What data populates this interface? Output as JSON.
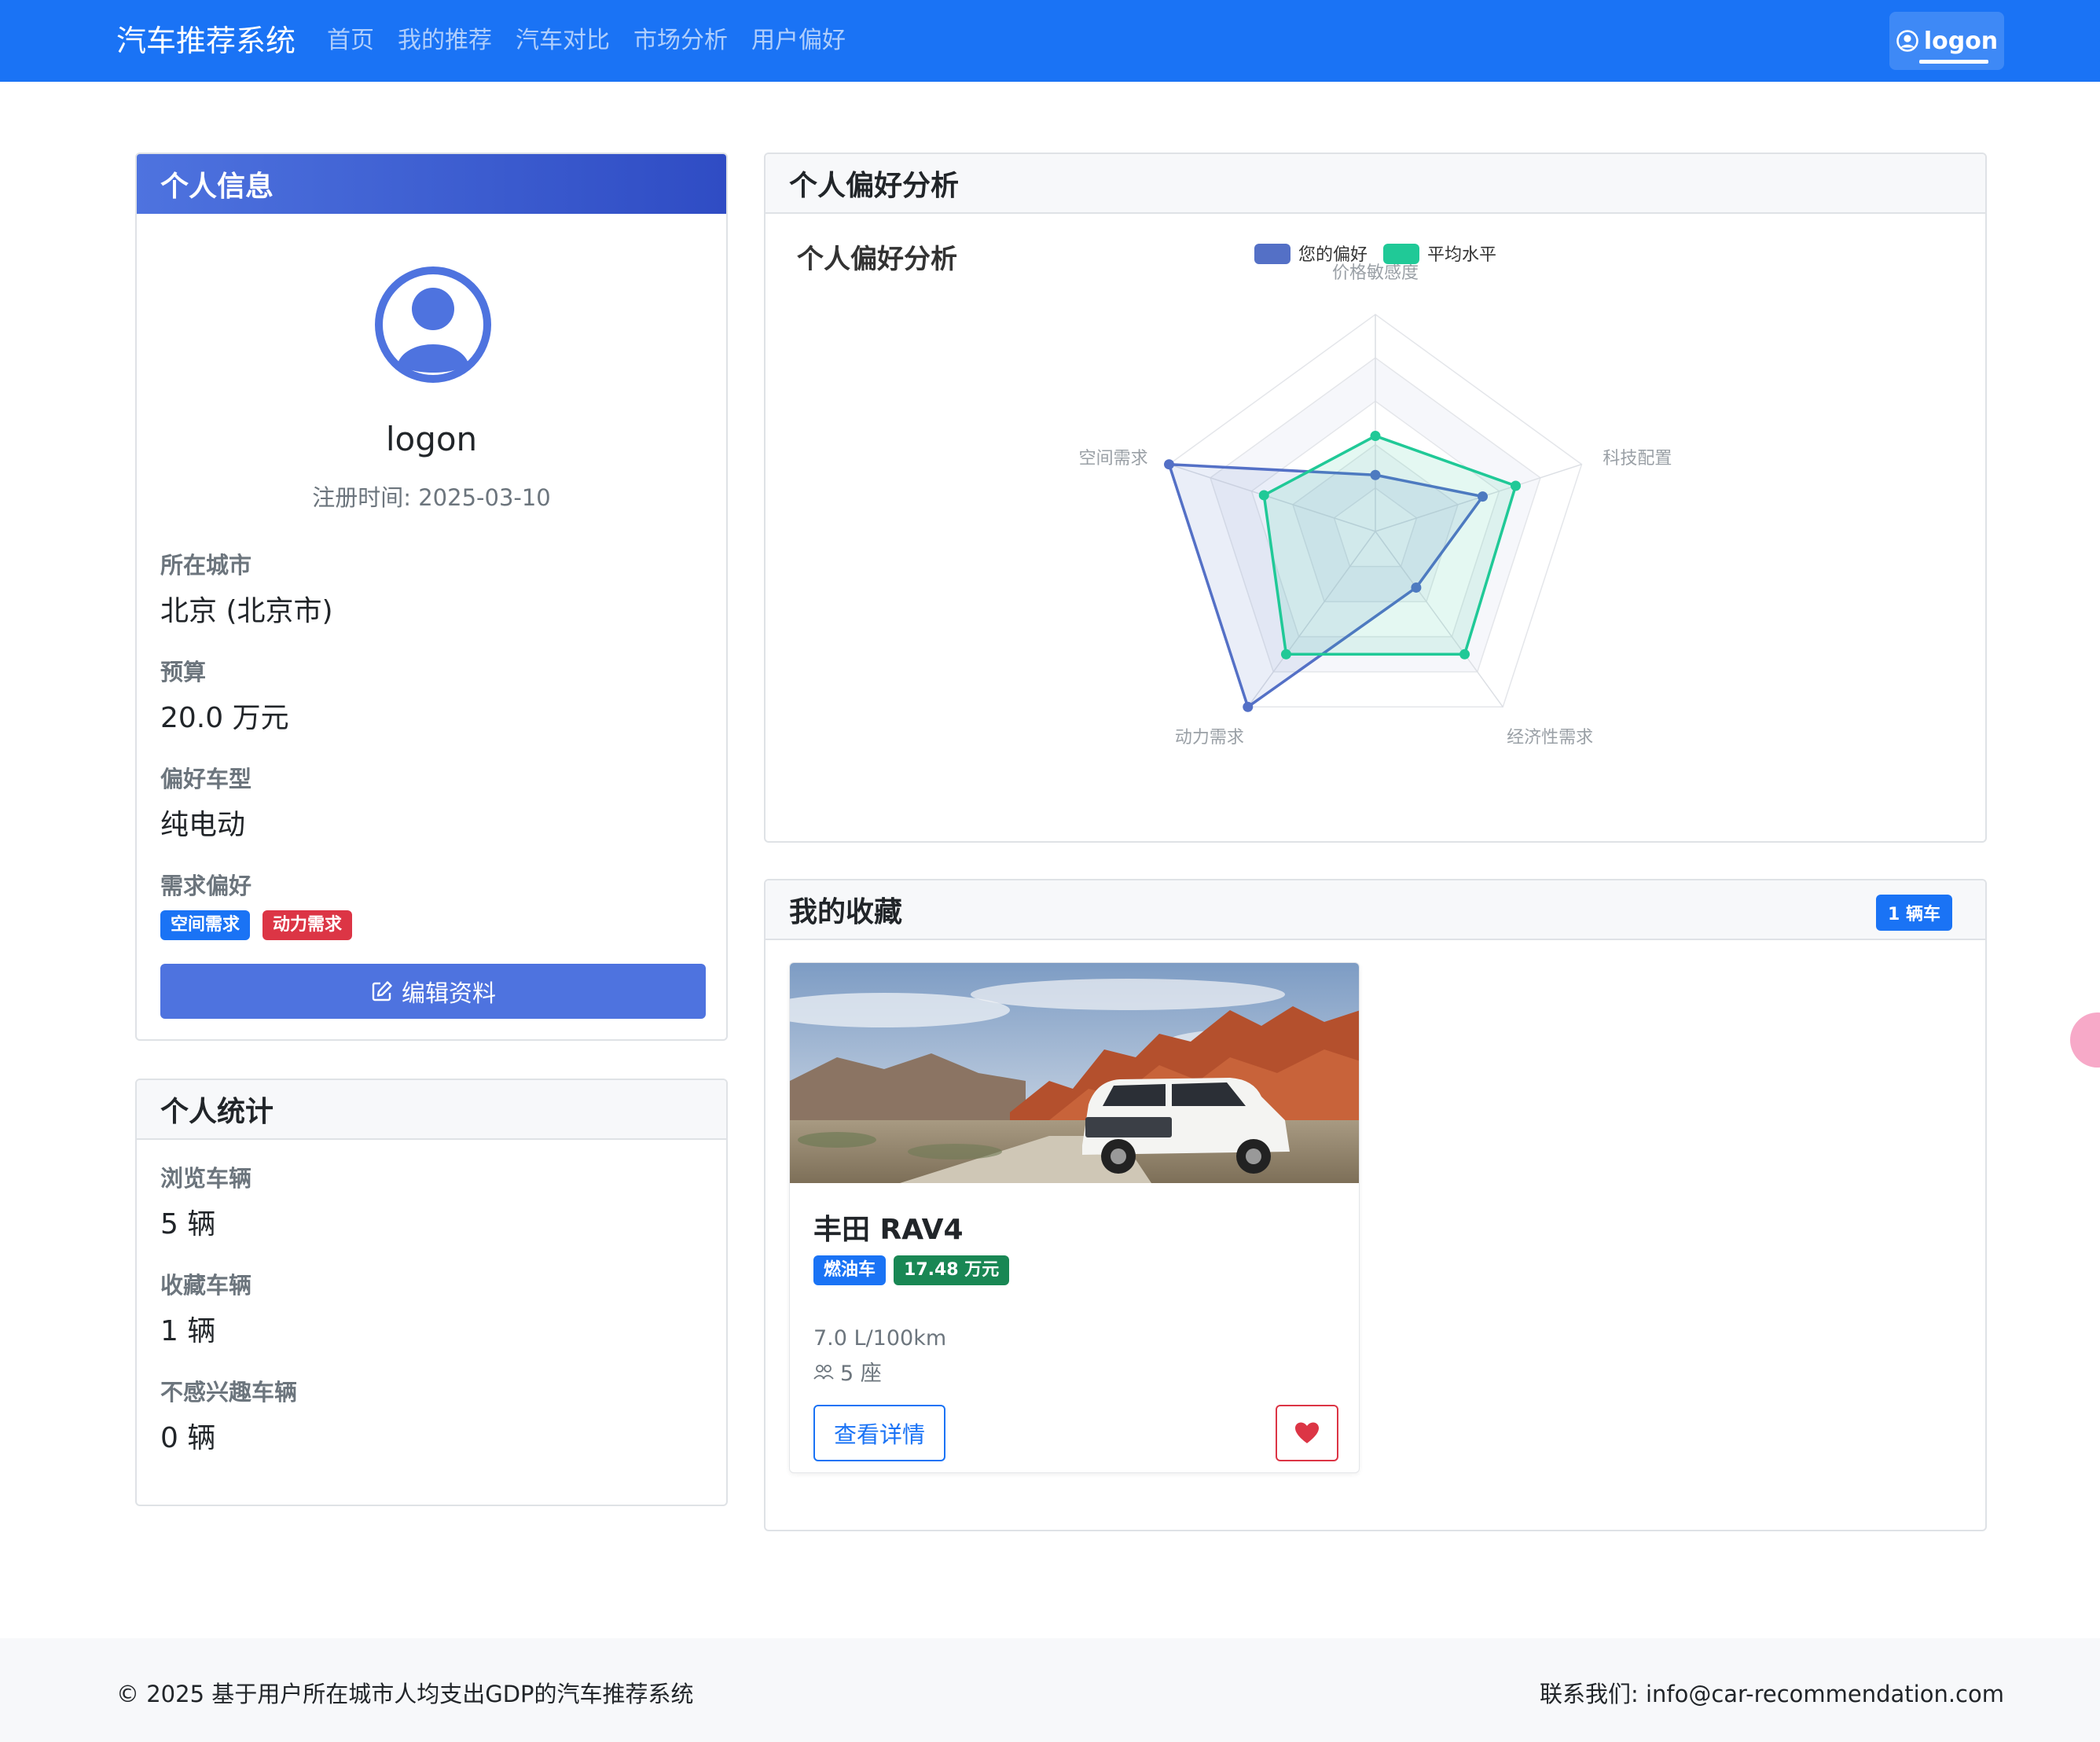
{
  "nav": {
    "brand": "汽车推荐系统",
    "links": [
      "首页",
      "我的推荐",
      "汽车对比",
      "市场分析",
      "用户偏好"
    ],
    "user": "logon"
  },
  "profile": {
    "header": "个人信息",
    "username": "logon",
    "register_time": "注册时间: 2025-03-10",
    "fields": [
      {
        "label": "所在城市",
        "value": "北京 (北京市)"
      },
      {
        "label": "预算",
        "value": "20.0 万元"
      },
      {
        "label": "偏好车型",
        "value": "纯电动"
      }
    ],
    "needs_label": "需求偏好",
    "needs_tags": [
      "空间需求",
      "动力需求"
    ],
    "edit_button": "编辑资料"
  },
  "stats": {
    "header": "个人统计",
    "items": [
      {
        "label": "浏览车辆",
        "value": "5 辆"
      },
      {
        "label": "收藏车辆",
        "value": "1 辆"
      },
      {
        "label": "不感兴趣车辆",
        "value": "0 辆"
      }
    ]
  },
  "preference": {
    "header": "个人偏好分析"
  },
  "chart_data": {
    "type": "radar",
    "title": "个人偏好分析",
    "indicators": [
      "价格敏感度",
      "科技配置",
      "经济性需求",
      "动力需求",
      "空间需求"
    ],
    "max": 5,
    "series": [
      {
        "name": "您的偏好",
        "values": [
          1.3,
          2.6,
          1.6,
          5.0,
          5.0
        ],
        "color": "#5470c6"
      },
      {
        "name": "平均水平",
        "values": [
          2.2,
          3.4,
          3.5,
          3.5,
          2.7
        ],
        "color": "#20c997"
      }
    ],
    "legend": "top-center",
    "split_number": 5
  },
  "favorites": {
    "header": "我的收藏",
    "count_badge": "1 辆车",
    "cars": [
      {
        "name": "丰田 RAV4",
        "fuel_tag": "燃油车",
        "price_tag": "17.48 万元",
        "consumption": "7.0 L/100km",
        "seats": "5 座",
        "detail_button": "查看详情"
      }
    ]
  },
  "footer": {
    "left": "© 2025 基于用户所在城市人均支出GDP的汽车推荐系统",
    "right": "联系我们: info@car-recommendation.com"
  },
  "colors": {
    "primary": "#1a73f5",
    "accent": "#4e73df",
    "danger": "#dc3545",
    "success": "#198754",
    "user_series": "#5470c6",
    "avg_series": "#20c997"
  }
}
